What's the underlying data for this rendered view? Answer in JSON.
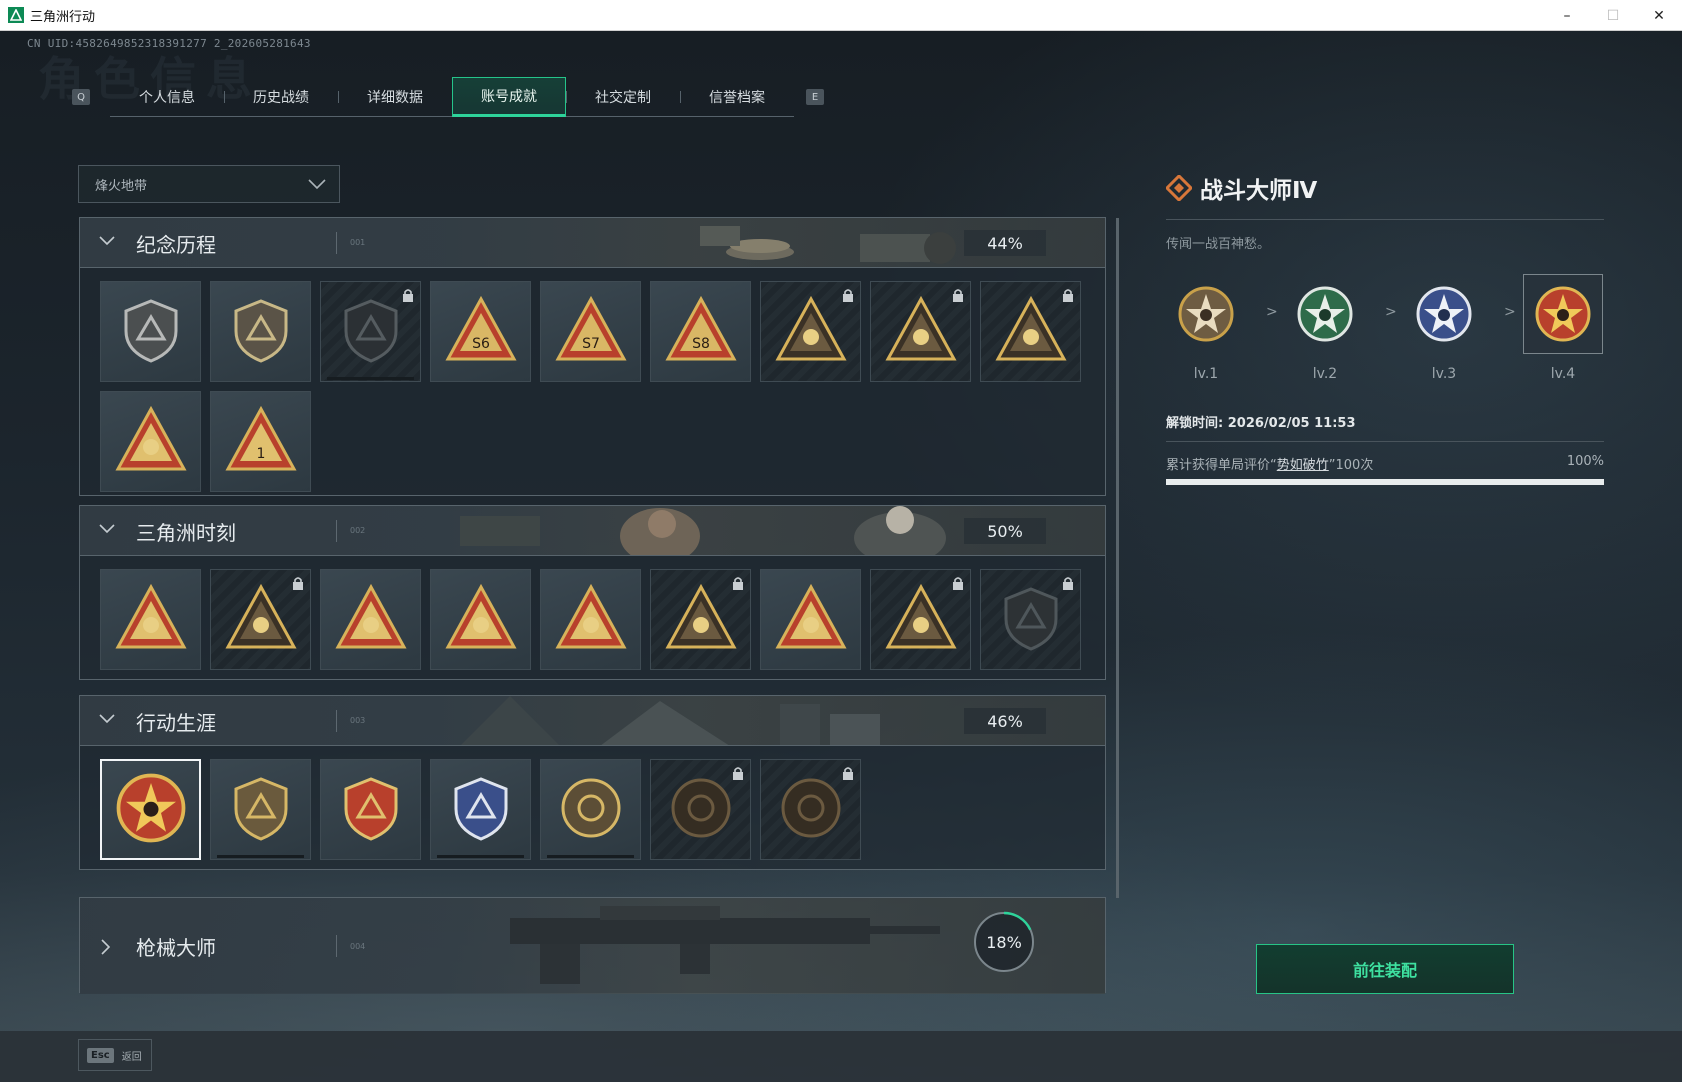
{
  "window": {
    "title": "三角洲行动",
    "min": "–",
    "max": "☐",
    "close": "✕"
  },
  "header": {
    "uid": "CN UID:4582649852318391277 2_202605281643",
    "bg_title": "角色信息",
    "key_left": "Q",
    "key_right": "E",
    "tabs": [
      "个人信息",
      "历史战绩",
      "详细数据",
      "账号成就",
      "社交定制",
      "信誉档案"
    ],
    "active_tab": 3
  },
  "filter": {
    "selected": "烽火地带"
  },
  "categories": [
    {
      "title": "纪念历程",
      "idx": "001",
      "percent": "44%",
      "expanded": true
    },
    {
      "title": "三角洲时刻",
      "idx": "002",
      "percent": "50%",
      "expanded": true
    },
    {
      "title": "行动生涯",
      "idx": "003",
      "percent": "46%",
      "expanded": true
    },
    {
      "title": "枪械大师",
      "idx": "004",
      "percent": "18%",
      "expanded": false,
      "progress": 0.18
    }
  ],
  "detail": {
    "title": "战斗大师Ⅳ",
    "description": "传闻一战百神愁。",
    "levels": [
      "lv.1",
      "lv.2",
      "lv.3",
      "lv.4"
    ],
    "arrow": ">",
    "unlock_time": "解锁时间: 2026/02/05 11:53",
    "requirement_prefix": "累计获得单局评价“",
    "requirement_highlight": "势如破竹",
    "requirement_suffix": "”100次",
    "requirement_percent": "100%",
    "requirement_progress": 1.0,
    "equip_button": "前往装配"
  },
  "footer": {
    "esc_key": "Esc",
    "esc_label": "返回"
  },
  "colors": {
    "accent": "#2ed39a",
    "gold": "#c9a14a",
    "red": "#b8402c"
  }
}
